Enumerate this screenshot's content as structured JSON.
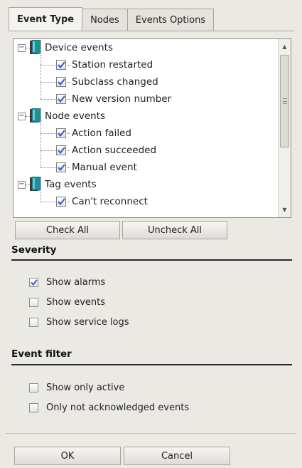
{
  "tabs": [
    {
      "label": "Event Type",
      "active": true
    },
    {
      "label": "Nodes",
      "active": false
    },
    {
      "label": "Events Options",
      "active": false
    }
  ],
  "tree": {
    "groups": [
      {
        "label": "Device events",
        "expanded": true,
        "items": [
          {
            "label": "Station restarted",
            "checked": true
          },
          {
            "label": "Subclass changed",
            "checked": true
          },
          {
            "label": "New version number",
            "checked": true
          }
        ]
      },
      {
        "label": "Node events",
        "expanded": true,
        "items": [
          {
            "label": "Action failed",
            "checked": true
          },
          {
            "label": "Action succeeded",
            "checked": true
          },
          {
            "label": "Manual event",
            "checked": true
          }
        ]
      },
      {
        "label": "Tag events",
        "expanded": true,
        "items": [
          {
            "label": "Can't reconnect",
            "checked": true
          }
        ]
      }
    ]
  },
  "tree_buttons": {
    "check_all": "Check All",
    "uncheck_all": "Uncheck All"
  },
  "severity": {
    "title": "Severity",
    "options": [
      {
        "label": "Show alarms",
        "checked": true
      },
      {
        "label": "Show events",
        "checked": false
      },
      {
        "label": "Show service logs",
        "checked": false
      }
    ]
  },
  "event_filter": {
    "title": "Event filter",
    "options": [
      {
        "label": "Show only active",
        "checked": false
      },
      {
        "label": "Only not acknowledged events",
        "checked": false
      }
    ]
  },
  "footer": {
    "ok": "OK",
    "cancel": "Cancel"
  },
  "colors": {
    "checkmark": "#3a5fcd",
    "book_teal": "#1f8f9a",
    "book_dark": "#3a3a3a"
  }
}
